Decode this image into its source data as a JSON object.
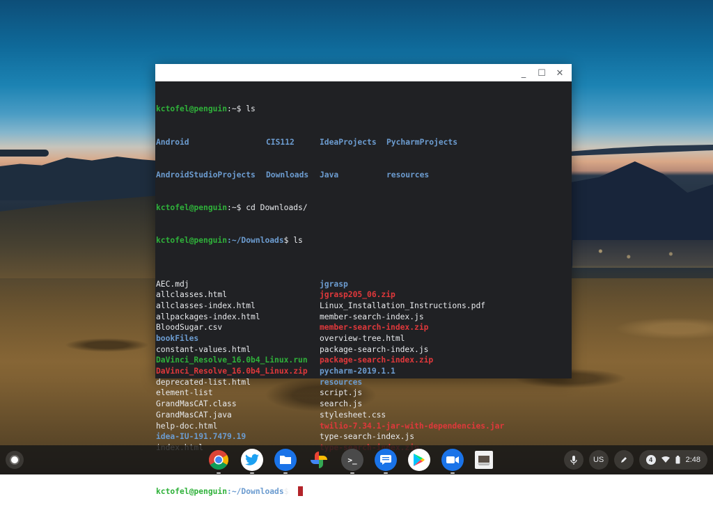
{
  "window": {
    "controls": {
      "minimize": "_",
      "maximize": "☐",
      "close": "✕"
    }
  },
  "terminal": {
    "user_host": "kctofel@penguin",
    "lines": {
      "p1": {
        "path": ":~",
        "cmd": "$ ls"
      },
      "home_ls": [
        [
          "Android",
          "CIS112",
          "IdeaProjects",
          "PycharmProjects"
        ],
        [
          "AndroidStudioProjects",
          "Downloads",
          "Java",
          "resources"
        ]
      ],
      "p2": {
        "path": ":~",
        "cmd": "$ cd Downloads/"
      },
      "p3": {
        "path": ":~/Downloads",
        "cmd": "$ ls"
      },
      "p4": {
        "path": ":~/Downloads",
        "cmd": "$ "
      }
    },
    "downloads_left": [
      {
        "name": "AEC.mdj",
        "type": "file"
      },
      {
        "name": "allclasses.html",
        "type": "file"
      },
      {
        "name": "allclasses-index.html",
        "type": "file"
      },
      {
        "name": "allpackages-index.html",
        "type": "file"
      },
      {
        "name": "BloodSugar.csv",
        "type": "file"
      },
      {
        "name": "bookFiles",
        "type": "dir"
      },
      {
        "name": "constant-values.html",
        "type": "file"
      },
      {
        "name": "DaVinci_Resolve_16.0b4_Linux.run",
        "type": "exec"
      },
      {
        "name": "DaVinci_Resolve_16.0b4_Linux.zip",
        "type": "arch"
      },
      {
        "name": "deprecated-list.html",
        "type": "file"
      },
      {
        "name": "element-list",
        "type": "file"
      },
      {
        "name": "GrandMasCAT.class",
        "type": "file"
      },
      {
        "name": "GrandMasCAT.java",
        "type": "file"
      },
      {
        "name": "help-doc.html",
        "type": "file"
      },
      {
        "name": "idea-IU-191.7479.19",
        "type": "dir"
      },
      {
        "name": "index.html",
        "type": "file"
      }
    ],
    "downloads_right": [
      {
        "name": "jgrasp",
        "type": "dir"
      },
      {
        "name": "jgrasp205_06.zip",
        "type": "arch"
      },
      {
        "name": "Linux_Installation_Instructions.pdf",
        "type": "file"
      },
      {
        "name": "member-search-index.js",
        "type": "file"
      },
      {
        "name": "member-search-index.zip",
        "type": "arch"
      },
      {
        "name": "overview-tree.html",
        "type": "file"
      },
      {
        "name": "package-search-index.js",
        "type": "file"
      },
      {
        "name": "package-search-index.zip",
        "type": "arch"
      },
      {
        "name": "pycharm-2019.1.1",
        "type": "dir"
      },
      {
        "name": "resources",
        "type": "dir"
      },
      {
        "name": "script.js",
        "type": "file"
      },
      {
        "name": "search.js",
        "type": "file"
      },
      {
        "name": "stylesheet.css",
        "type": "file"
      },
      {
        "name": "twilio-7.34.1-jar-with-dependencies.jar",
        "type": "arch"
      },
      {
        "name": "type-search-index.js",
        "type": "file"
      },
      {
        "name": "type-search-index.zip",
        "type": "arch"
      }
    ],
    "colors": {
      "background": "#202124",
      "prompt_user": "#2fb13a",
      "prompt_path": "#6c9cd0",
      "directory": "#6c9cd0",
      "executable": "#2fb13a",
      "archive": "#e0383b",
      "file": "#e8eaed",
      "cursor": "#b3242a"
    }
  },
  "shelf": {
    "apps": [
      {
        "name": "Chrome",
        "icon": "chrome-icon"
      },
      {
        "name": "Twitter",
        "icon": "twitter-icon"
      },
      {
        "name": "Files",
        "icon": "files-icon"
      },
      {
        "name": "Google Photos",
        "icon": "photos-icon"
      },
      {
        "name": "Terminal",
        "icon": "terminal-icon",
        "glyph": ">_"
      },
      {
        "name": "Messages",
        "icon": "messages-icon"
      },
      {
        "name": "Play Store",
        "icon": "play-store-icon"
      },
      {
        "name": "Zoom",
        "icon": "zoom-icon"
      },
      {
        "name": "Window preview",
        "icon": "window-thumbnail-icon"
      }
    ],
    "tray": {
      "mic": "microphone-icon",
      "ime": "US",
      "stylus": "stylus-icon",
      "notification_count": "4",
      "time": "2:48"
    }
  }
}
